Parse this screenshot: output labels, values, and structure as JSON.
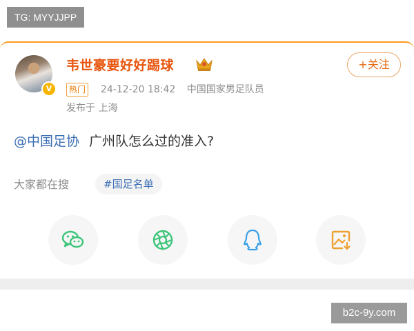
{
  "watermark_top": "TG: MYYJJPP",
  "post": {
    "username": "韦世豪要好好踢球",
    "follow_label": "+关注",
    "hot_badge": "热门",
    "timestamp": "24-12-20 18:42",
    "title": "中国国家男足队员",
    "location": "发布于 上海",
    "mention": "@中国足协",
    "text": "广州队怎么过的准入?"
  },
  "search": {
    "label": "大家都在搜",
    "tag": "#国足名单"
  },
  "share": {
    "icons": [
      "wechat-icon",
      "moments-icon",
      "qq-icon",
      "save-image-icon"
    ]
  },
  "watermark_bottom": "b2c-9y.com",
  "colors": {
    "accent": "#e8560f",
    "link": "#3c6fb5",
    "wechat": "#3ec57a",
    "moments": "#3ec57a",
    "qq": "#3aa0e8",
    "save": "#f0a030"
  }
}
